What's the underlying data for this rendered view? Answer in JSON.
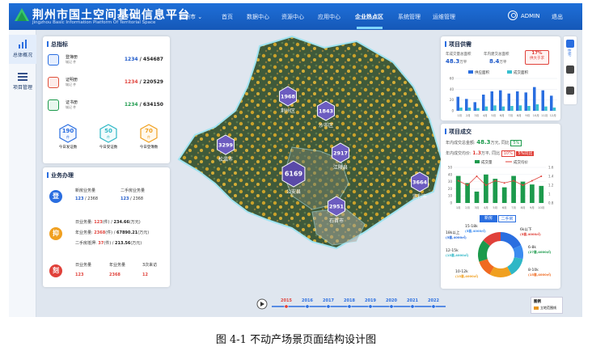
{
  "header": {
    "title": "荆州市国土空间基础信息平台",
    "subtitle": "Jingzhou Basic Information Platform Of Territorial Space",
    "city_selector": "荆州市 ⌄",
    "nav": [
      "首页",
      "数据中心",
      "资源中心",
      "应用中心",
      "企业热点区",
      "系统管理",
      "运维管理"
    ],
    "active_nav": "企业热点区",
    "user": "ADMIN",
    "logout": "退出"
  },
  "sidebar": {
    "items": [
      {
        "label": "总体概况",
        "icon": "bar-chart-icon",
        "active": true
      },
      {
        "label": "项目管理",
        "icon": "list-icon",
        "active": false
      }
    ]
  },
  "total_indicators": {
    "title": "总指标",
    "rows": [
      {
        "name": "登簿册",
        "sub": "城记  件",
        "current": "1234",
        "total": "/ 454687",
        "color": "#2a6ee0",
        "accent": "blue"
      },
      {
        "name": "证明册",
        "sub": "城记  件",
        "current": "1234",
        "total": "/ 220529",
        "color": "#e0503a",
        "accent": "red"
      },
      {
        "name": "证书册",
        "sub": "城记  件",
        "current": "1234",
        "total": "/ 634150",
        "color": "#1c9a4c",
        "accent": "green"
      }
    ],
    "today": [
      {
        "value": "190",
        "unit": "件",
        "label": "今日发证数",
        "color": "#2a6ee0"
      },
      {
        "value": "50",
        "unit": "件",
        "label": "今日受证数",
        "color": "#2fb7c6"
      },
      {
        "value": "70",
        "unit": "件",
        "label": "今日登簿数",
        "color": "#f0a020"
      }
    ]
  },
  "business": {
    "title": "业务办理",
    "groups": [
      {
        "icon_char": "登",
        "color": "#2a6ee0",
        "left_label": "新房业务量",
        "right_label": "二手房业务量",
        "left_value": "123",
        "left_total": "/ 2368",
        "right_value": "123",
        "right_total": "/ 2368"
      },
      {
        "icon_char": "抑",
        "color": "#f0a020",
        "lines": [
          {
            "label": "日业务量:",
            "value": "123",
            "unit": "(件)",
            "sep": "/",
            "amount": "234.66",
            "amount_unit": "(万元)"
          },
          {
            "label": "年业务量:",
            "value": "2368",
            "unit": "(件)",
            "sep": "/",
            "amount": "67890.21",
            "amount_unit": "(万元)"
          },
          {
            "label": "二手房抵押:",
            "value": "37",
            "unit": "(件)",
            "sep": "/",
            "amount": "213.56",
            "amount_unit": "(万元)"
          }
        ]
      },
      {
        "icon_char": "刻",
        "color": "#e0413a",
        "cols": [
          {
            "label": "日业务量",
            "value": "123"
          },
          {
            "label": "年业务量",
            "value": "2368"
          },
          {
            "label": "3次来访",
            "value": "12"
          }
        ]
      }
    ]
  },
  "map": {
    "regions": [
      {
        "name": "荆州区",
        "value": "1968"
      },
      {
        "name": "沙市区",
        "value": "1843"
      },
      {
        "name": "松滋市",
        "value": "3299"
      },
      {
        "name": "江陵县",
        "value": "2917"
      },
      {
        "name": "公安县",
        "value": "6169"
      },
      {
        "name": "石首市",
        "value": "2951"
      },
      {
        "name": "监利市",
        "value": "3664"
      }
    ]
  },
  "supply": {
    "title": "项目供需",
    "stats": [
      {
        "label": "年成交量总面积",
        "value": "48.3",
        "unit": "万平"
      },
      {
        "label": "年内建交总面积",
        "value": "8.4",
        "unit": "万平"
      }
    ],
    "badge": {
      "value": "17%",
      "label": "供大于求"
    },
    "legend": [
      "供应面积",
      "成交面积"
    ],
    "chart_data": {
      "type": "bar",
      "categories": [
        "1月",
        "2月",
        "3月",
        "4月",
        "5月",
        "6月",
        "7月",
        "8月",
        "9月",
        "10月",
        "11月",
        "12月"
      ],
      "series": [
        {
          "name": "供应面积",
          "values": [
            26,
            22,
            16,
            30,
            36,
            38,
            32,
            36,
            34,
            44,
            38,
            28
          ]
        },
        {
          "name": "成交面积",
          "values": [
            6,
            6,
            5,
            8,
            10,
            8,
            9,
            10,
            9,
            12,
            8,
            6
          ]
        }
      ],
      "yticks": [
        "60",
        "40",
        "20",
        "0"
      ],
      "ylim": [
        0,
        60
      ]
    }
  },
  "deals": {
    "title": "项目成交",
    "line1": {
      "label": "年内成交总金额:",
      "value": "48.3",
      "unit": "万元,",
      "tag": "同比",
      "badge": "5%"
    },
    "line2": {
      "label": "年内成交均价:",
      "value": "1.3",
      "unit": "万平,",
      "tag": "同比",
      "badge1": "10%",
      "badge2": "5%同比"
    },
    "legend": [
      "成交量",
      "成交均价"
    ],
    "chart_data": {
      "type": "bar",
      "categories": [
        "1月",
        "2月",
        "3月",
        "4月",
        "5月",
        "6月",
        "7月",
        "8月",
        "9月",
        "10月"
      ],
      "series": [
        {
          "name": "成交量",
          "values": [
            38,
            28,
            16,
            40,
            34,
            22,
            38,
            30,
            26,
            24
          ]
        },
        {
          "name": "成交均价",
          "values": [
            1.3,
            1.2,
            1.4,
            1.2,
            1.3,
            1.25,
            1.3,
            1.2,
            1.3,
            1.4
          ]
        }
      ],
      "yticks_left": [
        "50",
        "40",
        "30",
        "20",
        "10",
        "0"
      ],
      "yticks_right": [
        "1.6",
        "1.4",
        "1.2",
        "1",
        "0.8"
      ],
      "ylim": [
        0,
        50
      ],
      "y2lim": [
        0.8,
        1.6
      ]
    }
  },
  "price_pie": {
    "tabs": [
      "新房",
      "二手房"
    ],
    "active_tab": "新房",
    "chart_data": {
      "type": "pie",
      "slices": [
        {
          "label": "18k以上",
          "count": "(5套,4000㎡)",
          "value": 18,
          "color": "#2a6ee0"
        },
        {
          "label": "15-18k",
          "count": "(5套,4000㎡)",
          "value": 10,
          "color": "#3b8cf0"
        },
        {
          "label": "12-15k",
          "count": "(15套,4000㎡)",
          "value": 14,
          "color": "#2fb7c6"
        },
        {
          "label": "10-12k",
          "count": "(15套,4000㎡)",
          "value": 16,
          "color": "#f0a020"
        },
        {
          "label": "8-10k",
          "count": "(15套,4000㎡)",
          "value": 12,
          "color": "#f06a20"
        },
        {
          "label": "6-8k",
          "count": "(27套,4000㎡)",
          "value": 16,
          "color": "#1c9a4c"
        },
        {
          "label": "6k以下",
          "count": "(5套,4000㎡)",
          "value": 14,
          "color": "#e0413a"
        }
      ]
    }
  },
  "timeline": {
    "years": [
      "2015",
      "2016",
      "2017",
      "2018",
      "2019",
      "2020",
      "2021",
      "2022"
    ],
    "active": "2015"
  },
  "map_legend": {
    "title": "图例",
    "item": "立地范围线"
  },
  "caption": "图 4-1  不动产场景页面结构设计图",
  "colors": {
    "primary": "#1e6fd8",
    "accent_red": "#e0413a",
    "accent_green": "#1c9a4c",
    "accent_orange": "#f0a020"
  }
}
